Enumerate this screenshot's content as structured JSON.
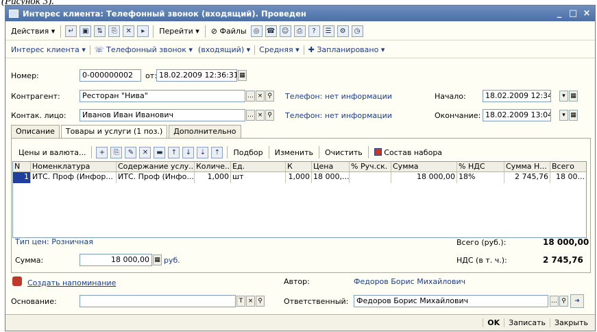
{
  "caption": "(Рисунок 3).",
  "window": {
    "title": "Интерес клиента: Телефонный звонок (входящий). Проведен"
  },
  "toolbar": {
    "actions": "Действия",
    "goto": "Перейти",
    "files": "Файлы"
  },
  "menu2": {
    "interest": "Интерес клиента",
    "call": "Телефонный звонок",
    "incoming": "(входящий)",
    "priority": "Средняя",
    "planned": "Запланировано"
  },
  "header": {
    "number_label": "Номер:",
    "number_value": "0-000000002",
    "from_label": "от:",
    "date_value": "18.02.2009 12:36:31",
    "contractor_label": "Контрагент:",
    "contractor_value": "Ресторан \"Нива\"",
    "contractor_phone": "Телефон: нет информации",
    "start_label": "Начало:",
    "start_value": "18.02.2009 12:34",
    "contact_label": "Контак. лицо:",
    "contact_value": "Иванов Иван Иванович",
    "contact_phone": "Телефон: нет информации",
    "end_label": "Окончание:",
    "end_value": "18.02.2009 13:04"
  },
  "tabs": [
    "Описание",
    "Товары и услуги (1 поз.)",
    "Дополнительно"
  ],
  "inner_toolbar": {
    "prices": "Цены и валюта...",
    "pick": "Подбор",
    "change": "Изменить",
    "clear": "Очистить",
    "kit": "Состав набора"
  },
  "table": {
    "columns": [
      "N",
      "Номенклатура",
      "Содержание услу...",
      "Количе...",
      "Ед.",
      "К",
      "Цена",
      "% Руч.ск.",
      "Сумма",
      "% НДС",
      "Сумма Н...",
      "Всего"
    ],
    "rows": [
      [
        "1",
        "ИТС. Проф (Инфор...",
        "ИТС. Проф (Инфо...",
        "1,000",
        "шт",
        "1,000",
        "18 000,...",
        "",
        "18 000,00",
        "18%",
        "2 745,76",
        "18 00..."
      ]
    ]
  },
  "totals": {
    "price_type": "Тип цен: Розничная",
    "sum_label": "Сумма:",
    "sum_value": "18 000,00",
    "currency": "руб.",
    "total_label": "Всего (руб.):",
    "total_value": "18 000,00",
    "vat_label": "НДС (в т. ч.):",
    "vat_value": "2 745,76"
  },
  "bottom": {
    "reminder": "Создать напоминание",
    "author_label": "Автор:",
    "author_value": "Федоров Борис Михайлович",
    "basis_label": "Основание:",
    "responsible_label": "Ответственный:",
    "responsible_value": "Федоров Борис Михайлович"
  },
  "status": {
    "ok": "OK",
    "save": "Записать",
    "close": "Закрыть"
  }
}
